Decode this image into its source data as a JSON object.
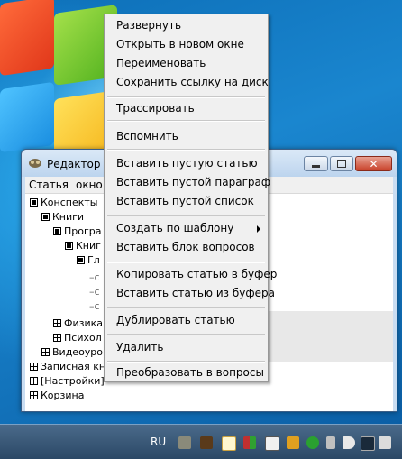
{
  "window": {
    "title": "Редактор с",
    "menu": [
      "Статья",
      "окно"
    ]
  },
  "tree": [
    {
      "label": "Конспекты",
      "kind": "filled"
    },
    {
      "label": "Книги",
      "kind": "filled"
    },
    {
      "label": "Програ",
      "kind": "filled"
    },
    {
      "label": "Книг",
      "kind": "filled"
    },
    {
      "label": "Гл",
      "kind": "filled"
    },
    {
      "label": "–с",
      "kind": "dash"
    },
    {
      "label": "–с",
      "kind": "dash"
    },
    {
      "label": "–с",
      "kind": "dash"
    },
    {
      "label": "Физика",
      "kind": "grid"
    },
    {
      "label": "Психол",
      "kind": "grid"
    },
    {
      "label": "Видеоуро",
      "kind": "grid"
    },
    {
      "label": "Записная кн",
      "kind": "grid"
    },
    {
      "label": "[Настройки]",
      "kind": "grid"
    },
    {
      "label": "Корзина",
      "kind": "grid"
    }
  ],
  "context_menu": {
    "items": [
      {
        "label": "Развернуть"
      },
      {
        "label": "Открыть в новом окне"
      },
      {
        "label": "Переименовать"
      },
      {
        "label": "Сохранить ссылку на диск"
      },
      {
        "label": "Трассировать"
      },
      {
        "label": "Вспомнить"
      },
      {
        "label": "Вставить пустую статью"
      },
      {
        "label": "Вставить пустой параграф"
      },
      {
        "label": "Вставить пустой список"
      },
      {
        "label": "Создать по шаблону",
        "submenu": true
      },
      {
        "label": "Вставить блок вопросов"
      },
      {
        "label": "Копировать статью в буфер"
      },
      {
        "label": "Вставить статью из буфера"
      },
      {
        "label": "Дублировать статью"
      },
      {
        "label": "Удалить"
      },
      {
        "label": "Преобразовать в вопросы"
      }
    ]
  },
  "taskbar": {
    "language": "RU",
    "tray_icons": [
      "tools-icon",
      "film-icon",
      "notepad-icon",
      "grid-app-icon",
      "table-app-icon",
      "network-app-icon",
      "shield-check-icon",
      "usb-drive-icon",
      "volume-icon",
      "network-monitor-icon",
      "flag-icon"
    ]
  }
}
